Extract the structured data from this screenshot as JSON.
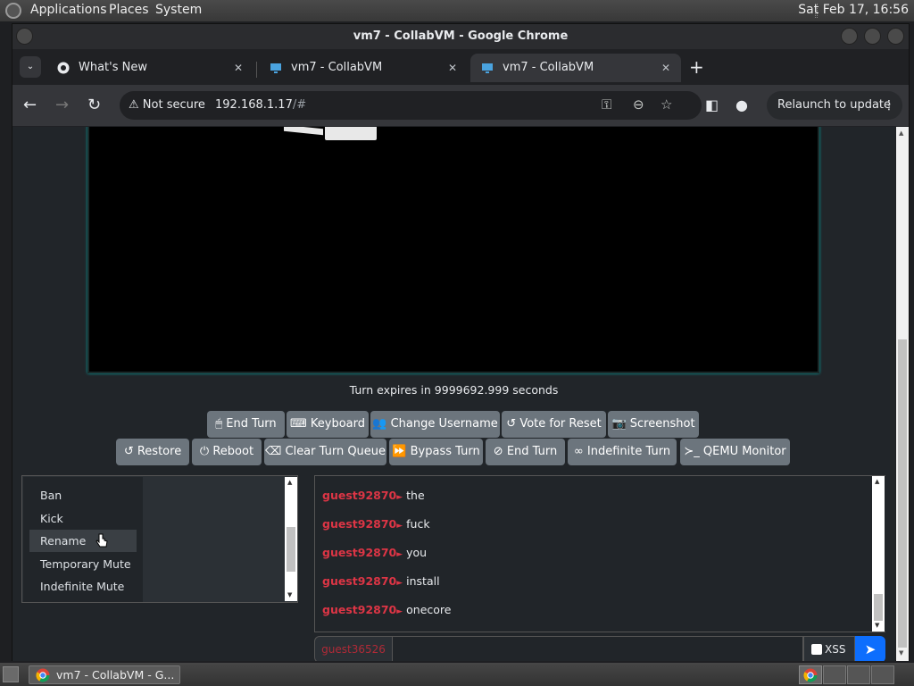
{
  "topbar": {
    "menus": [
      "Applications",
      "Places",
      "System"
    ],
    "clock": "Sat Feb 17, 16:56"
  },
  "window": {
    "title": "vm7 - CollabVM - Google Chrome"
  },
  "tabs": [
    {
      "title": "What's New"
    },
    {
      "title": "vm7 - CollabVM"
    },
    {
      "title": "vm7 - CollabVM"
    }
  ],
  "navbar": {
    "security": "Not secure",
    "url_host": "192.168.1.17",
    "url_path": "/#",
    "relaunch": "Relaunch to update"
  },
  "vm": {
    "turn_text": "Turn expires in 9999692.999 seconds"
  },
  "buttons_row1": [
    {
      "icon": "mouse-icon",
      "glyph": "🖱",
      "label": "End Turn"
    },
    {
      "icon": "keyboard-icon",
      "glyph": "⌨",
      "label": "Keyboard"
    },
    {
      "icon": "user-edit-icon",
      "glyph": "👥",
      "label": "Change Username"
    },
    {
      "icon": "undo-icon",
      "glyph": "↺",
      "label": "Vote for Reset"
    },
    {
      "icon": "camera-icon",
      "glyph": "📷",
      "label": "Screenshot"
    }
  ],
  "buttons_row2": [
    {
      "icon": "restore-icon",
      "glyph": "↺",
      "label": "Restore"
    },
    {
      "icon": "power-icon",
      "glyph": "⏻",
      "label": "Reboot"
    },
    {
      "icon": "eraser-icon",
      "glyph": "⌫",
      "label": "Clear Turn Queue"
    },
    {
      "icon": "forward-icon",
      "glyph": "⏩",
      "label": "Bypass Turn"
    },
    {
      "icon": "ban-icon",
      "glyph": "⊘",
      "label": "End Turn"
    },
    {
      "icon": "infinity-icon",
      "glyph": "∞",
      "label": "Indefinite Turn"
    },
    {
      "icon": "terminal-icon",
      "glyph": "≻_",
      "label": "QEMU Monitor"
    }
  ],
  "context_menu": [
    "Ban",
    "Kick",
    "Rename",
    "Temporary Mute",
    "Indefinite Mute"
  ],
  "chat": {
    "messages": [
      {
        "user": "guest92870",
        "text": "the"
      },
      {
        "user": "guest92870",
        "text": "fuck"
      },
      {
        "user": "guest92870",
        "text": "you"
      },
      {
        "user": "guest92870",
        "text": "install"
      },
      {
        "user": "guest92870",
        "text": "onecore"
      }
    ],
    "username": "guest36526",
    "xss_label": "XSS",
    "send_icon": "paper-plane-icon"
  },
  "taskbar": {
    "item": "vm7 - CollabVM - G..."
  },
  "colors": {
    "accent": "#0d6efd",
    "username": "#dc3545",
    "button": "#6c757d"
  }
}
